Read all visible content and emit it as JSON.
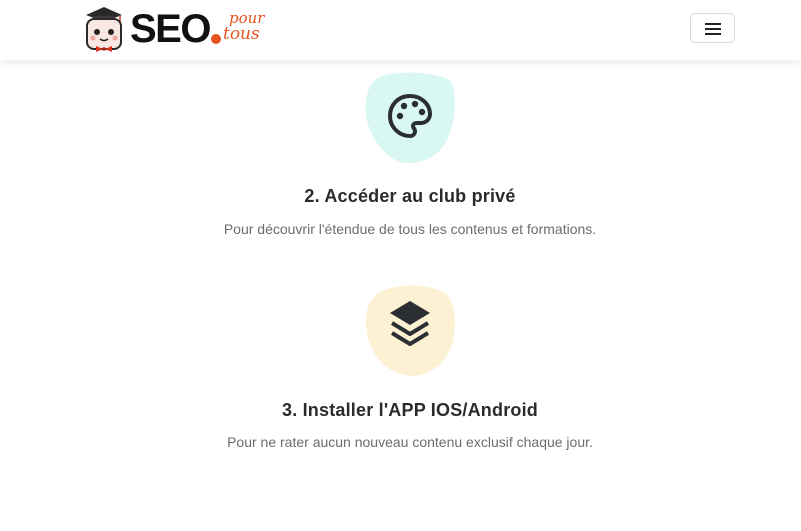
{
  "header": {
    "logo": {
      "brand": "SEO",
      "script_top": "pour",
      "script_bottom": "tous"
    },
    "menu_button_icon": "hamburger-menu-icon"
  },
  "steps": [
    {
      "title": "2. Accéder au club privé",
      "description": "Pour découvrir l'étendue de tous les contenus et formations.",
      "icon": "palette-icon",
      "blob_color": "#d9f7f3"
    },
    {
      "title": "3. Installer l'APP IOS/Android",
      "description": "Pour ne rater aucun nouveau contenu exclusif chaque jour.",
      "icon": "layers-icon",
      "blob_color": "#fdf1d4"
    }
  ],
  "colors": {
    "accent_orange": "#e8541e",
    "icon_dark": "#2b2e33"
  }
}
